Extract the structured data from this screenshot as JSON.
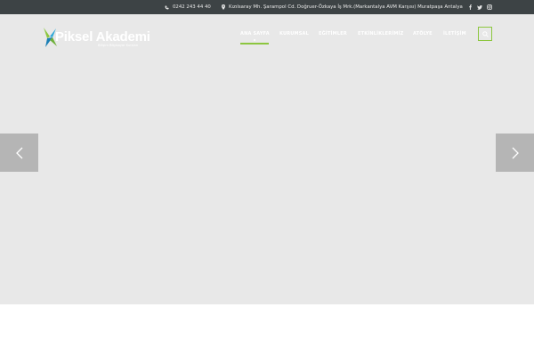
{
  "topbar": {
    "phone": "0242 243 44 40",
    "address": "Kızılsaray Mh. Şarampol Cd. Doğruer-Özkaya İş Mrk.(Markantalya AVM Karşısı) Muratpaşa Antalya",
    "social_icons": [
      "facebook-icon",
      "twitter-icon",
      "instagram-icon"
    ]
  },
  "logo": {
    "name": "Piksel Akademi",
    "tagline": "Bilişim Bilgisayar Kursları"
  },
  "nav": {
    "items": [
      "ANA SAYFA",
      "KURUMSAL",
      "EĞİTİMLER",
      "ETKİNLİKLERİMİZ",
      "ATÖLYE",
      "İLETİŞİM"
    ],
    "active_index": 0
  },
  "colors": {
    "topbar_bg": "#3d4345",
    "hero_bg": "#e8e8e8",
    "accent": "#8cc63f",
    "arrow_bg": "#b5b5b5"
  }
}
